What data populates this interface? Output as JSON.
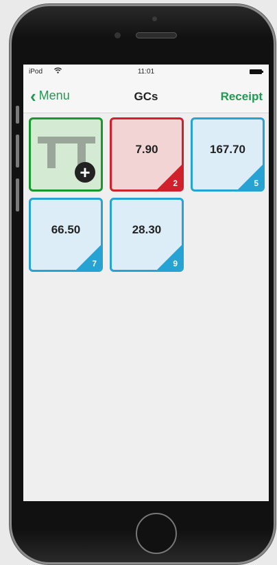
{
  "status": {
    "carrier": "iPod",
    "time": "11:01"
  },
  "nav": {
    "back_label": "Menu",
    "title": "GCs",
    "receipt_label": "Receipt"
  },
  "tiles": [
    {
      "amount": "7.90",
      "guests": "2",
      "state": "red"
    },
    {
      "amount": "167.70",
      "guests": "5",
      "state": "blue"
    },
    {
      "amount": "66.50",
      "guests": "7",
      "state": "blue"
    },
    {
      "amount": "28.30",
      "guests": "9",
      "state": "blue"
    }
  ],
  "colors": {
    "accent_green": "#1e9b52",
    "add_tile_border": "#16992c",
    "red_tile_border": "#d0202c",
    "blue_tile_border": "#26a2d3"
  },
  "icons": {
    "back": "chevron-left-icon",
    "add": "plus-circle-icon",
    "table": "table-icon"
  }
}
